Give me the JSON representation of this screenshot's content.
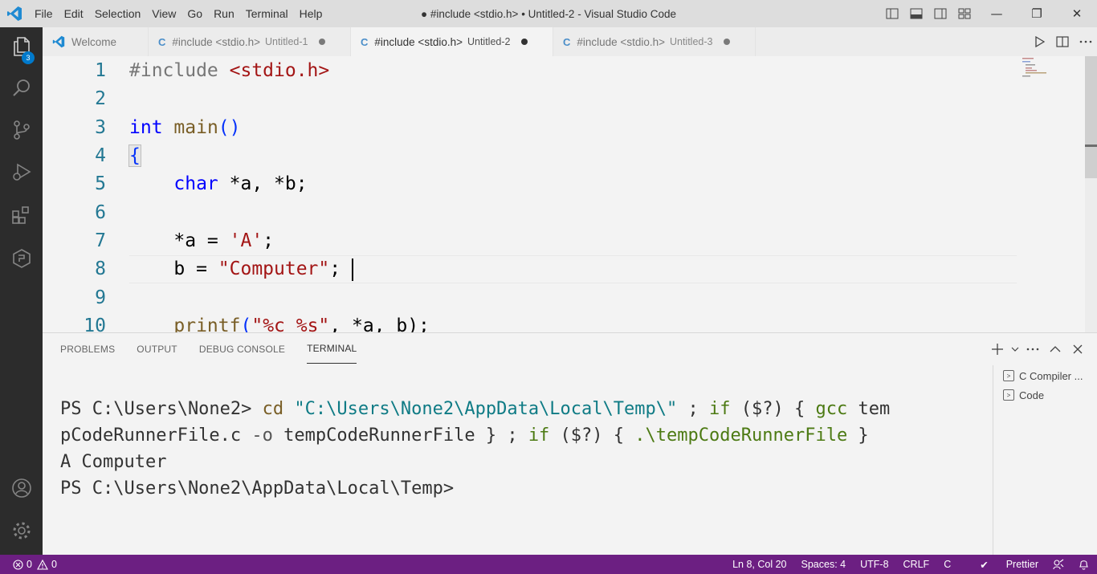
{
  "window": {
    "title": "● #include <stdio.h> • Untitled-2 - Visual Studio Code",
    "menu": [
      "File",
      "Edit",
      "Selection",
      "View",
      "Go",
      "Run",
      "Terminal",
      "Help"
    ],
    "controls": {
      "minimize": "—",
      "restore": "❐",
      "close": "✕"
    }
  },
  "activity_bar": {
    "explorer_badge": "3",
    "icons": [
      "files-icon",
      "search-icon",
      "source-control-icon",
      "run-debug-icon",
      "extensions-icon",
      "remote-icon",
      "account-icon",
      "settings-gear-icon"
    ]
  },
  "tabs": [
    {
      "label": "Welcome",
      "sub": "",
      "dirty": false,
      "active": false
    },
    {
      "label": "#include <stdio.h>",
      "sub": "Untitled-1",
      "dirty": true,
      "active": false
    },
    {
      "label": "#include <stdio.h>",
      "sub": "Untitled-2",
      "dirty": true,
      "active": true
    },
    {
      "label": "#include <stdio.h>",
      "sub": "Untitled-3",
      "dirty": true,
      "active": false
    }
  ],
  "tab_c_glyph": "C",
  "editor": {
    "line_numbers": [
      "1",
      "2",
      "3",
      "4",
      "5",
      "6",
      "7",
      "8",
      "9",
      "10"
    ],
    "lines": {
      "l1": {
        "a": "#include ",
        "b": "<stdio.h>"
      },
      "l3": {
        "a": "int",
        "b": " ",
        "c": "main",
        "d": "()"
      },
      "l4": {
        "a": "{"
      },
      "l5": {
        "a": "    ",
        "b": "char",
        "c": " *a, *b;"
      },
      "l7": {
        "a": "    *a = ",
        "b": "'A'",
        "c": ";"
      },
      "l8": {
        "a": "    b = ",
        "b": "\"Computer\"",
        "c": ";"
      },
      "l10": {
        "a": "    ",
        "b": "printf",
        "c": "(",
        "d": "\"%c %s\"",
        "e": ", *a, b);"
      }
    }
  },
  "panel": {
    "tabs": [
      "PROBLEMS",
      "OUTPUT",
      "DEBUG CONSOLE",
      "TERMINAL"
    ],
    "active_tab": "TERMINAL",
    "terminal": {
      "line1": {
        "prompt": "PS C:\\Users\\None2> ",
        "cmd": "cd",
        "sp1": " ",
        "path": "\"C:\\Users\\None2\\AppData\\Local\\Temp\\\"",
        "rest1": " ; ",
        "if1": "if",
        "rest2": " ($?) { ",
        "gcc": "gcc",
        "rest3": " tem"
      },
      "line2": {
        "a": "pCodeRunnerFile.c ",
        "opt": "-o",
        "b": " tempCodeRunnerFile } ; ",
        "if2": "if",
        "c": " ($?) { ",
        "exe": ".\\tempCodeRunnerFile",
        "d": " }"
      },
      "line3": "A Computer",
      "line4": "PS C:\\Users\\None2\\AppData\\Local\\Temp>"
    },
    "terminal_list": [
      "C Compiler ...",
      "Code"
    ]
  },
  "status_bar": {
    "errors": "0",
    "warnings": "0",
    "position": "Ln 8, Col 20",
    "spaces": "Spaces: 4",
    "encoding": "UTF-8",
    "eol": "CRLF",
    "language": "C",
    "formatter": "Prettier"
  },
  "colors": {
    "status_bar": "#6c1f82",
    "activity_bar": "#2c2c2c",
    "accent": "#007acc"
  }
}
